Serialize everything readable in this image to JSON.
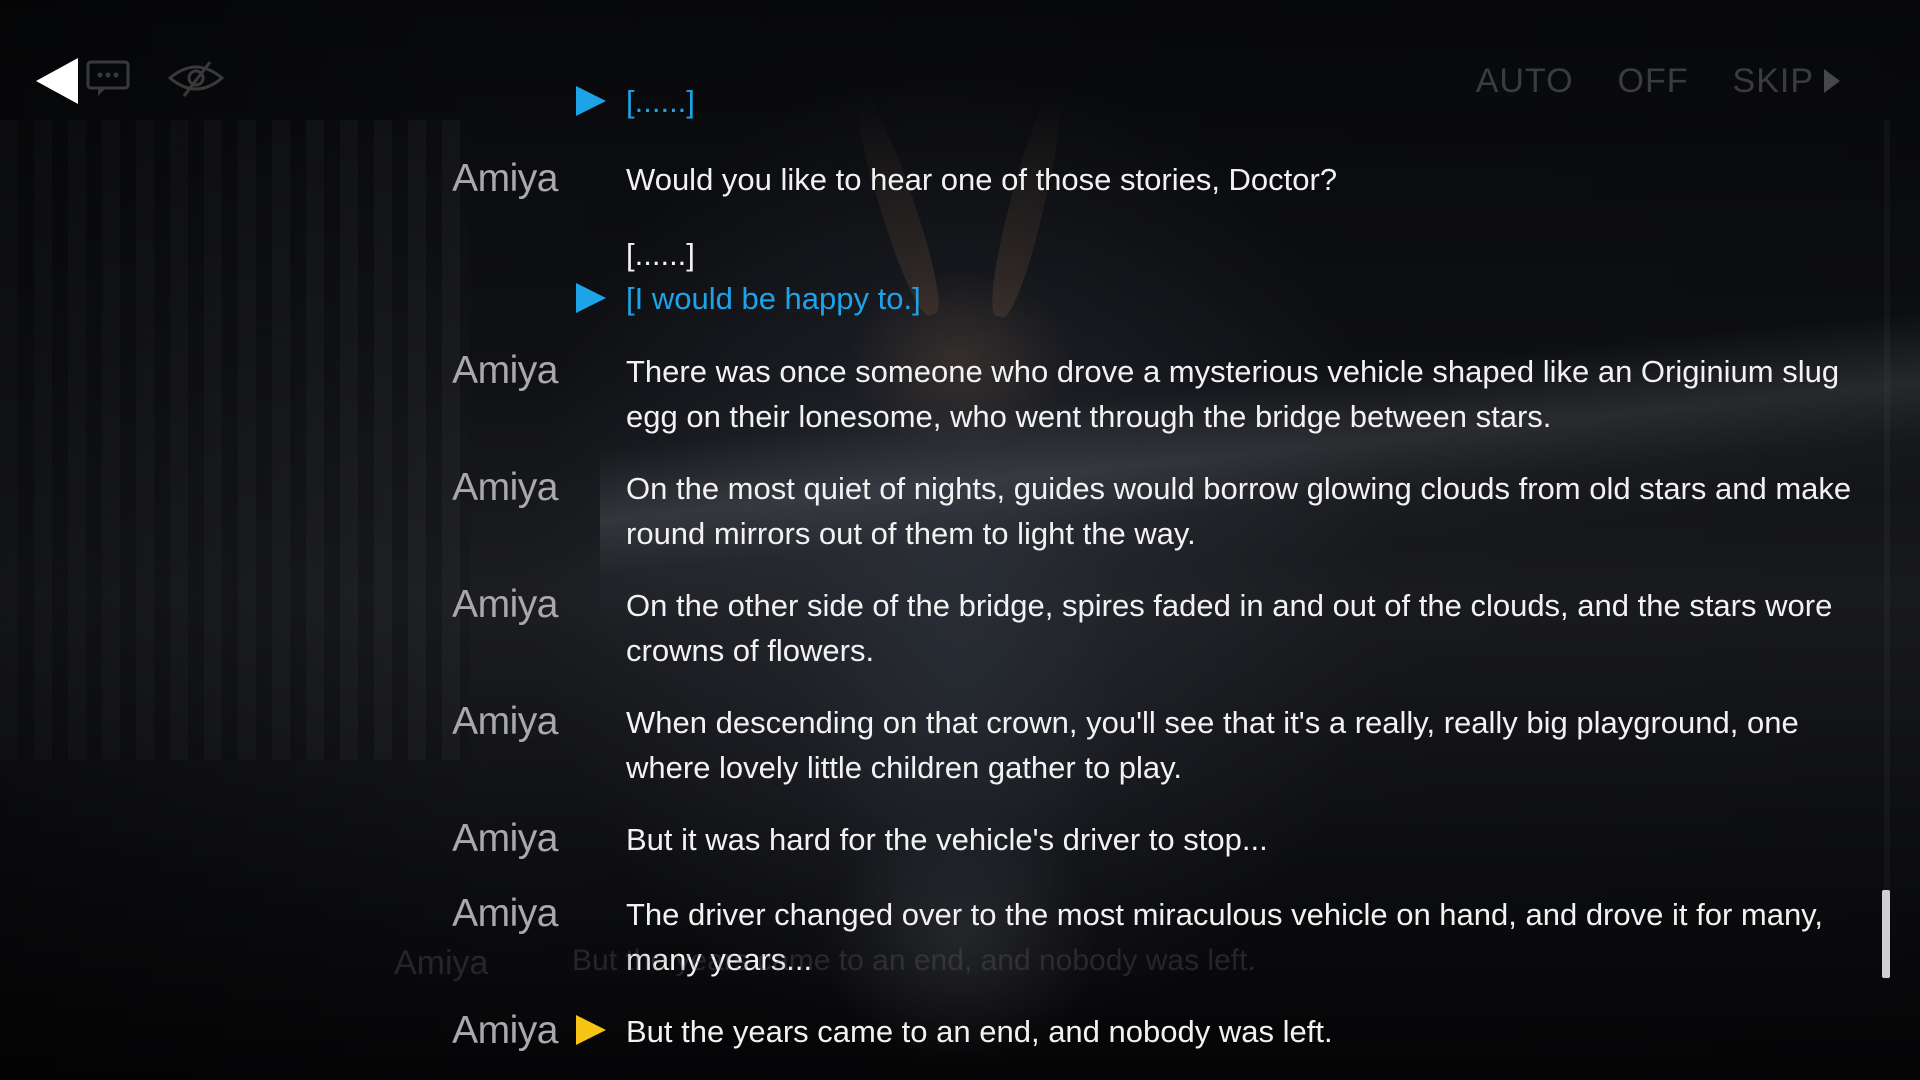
{
  "top_bar": {
    "back_icon": "back-arrow-icon",
    "log_icon": "dialogue-log-icon",
    "hide_icon": "hide-ui-eye-icon",
    "auto_label": "AUTO",
    "auto_state": "OFF",
    "skip_label": "SKIP"
  },
  "dialogue_log": [
    {
      "speaker": "",
      "text": "[......]",
      "kind": "choice",
      "marker": "blue"
    },
    {
      "speaker": "Amiya",
      "text": "Would you like to hear one of those stories, Doctor?",
      "kind": "line"
    },
    {
      "speaker": "",
      "text": "[......]",
      "kind": "option"
    },
    {
      "speaker": "",
      "text": "[I would be happy to.]",
      "kind": "choice",
      "marker": "blue"
    },
    {
      "speaker": "Amiya",
      "text": "There was once someone who drove a mysterious vehicle shaped like an Originium slug egg on their lonesome, who went through the bridge between stars.",
      "kind": "line"
    },
    {
      "speaker": "Amiya",
      "text": "On the most quiet of nights, guides would borrow glowing clouds from old stars and make round mirrors out of them to light the way.",
      "kind": "line"
    },
    {
      "speaker": "Amiya",
      "text": "On the other side of the bridge, spires faded in and out of the clouds, and the stars wore crowns of flowers.",
      "kind": "line"
    },
    {
      "speaker": "Amiya",
      "text": "When descending on that crown, you'll see that it's a really, really big playground, one where lovely little children gather to play.",
      "kind": "line"
    },
    {
      "speaker": "Amiya",
      "text": "But it was hard for the vehicle's driver to stop...",
      "kind": "line"
    },
    {
      "speaker": "Amiya",
      "text": "The driver changed over to the most miraculous vehicle on hand, and drove it for many, many years...",
      "kind": "line"
    },
    {
      "speaker": "Amiya",
      "text": "But the years came to an end, and nobody was left.",
      "kind": "line",
      "marker": "yellow"
    }
  ],
  "ghost_line": {
    "speaker": "Amiya",
    "text": "But the years came to an end, and nobody was left."
  },
  "colors": {
    "choice_blue": "#1ea3e8",
    "current_marker_yellow": "#f6c515",
    "speaker_gray": "#a9a9ad",
    "text_white": "#f2f2f2"
  }
}
